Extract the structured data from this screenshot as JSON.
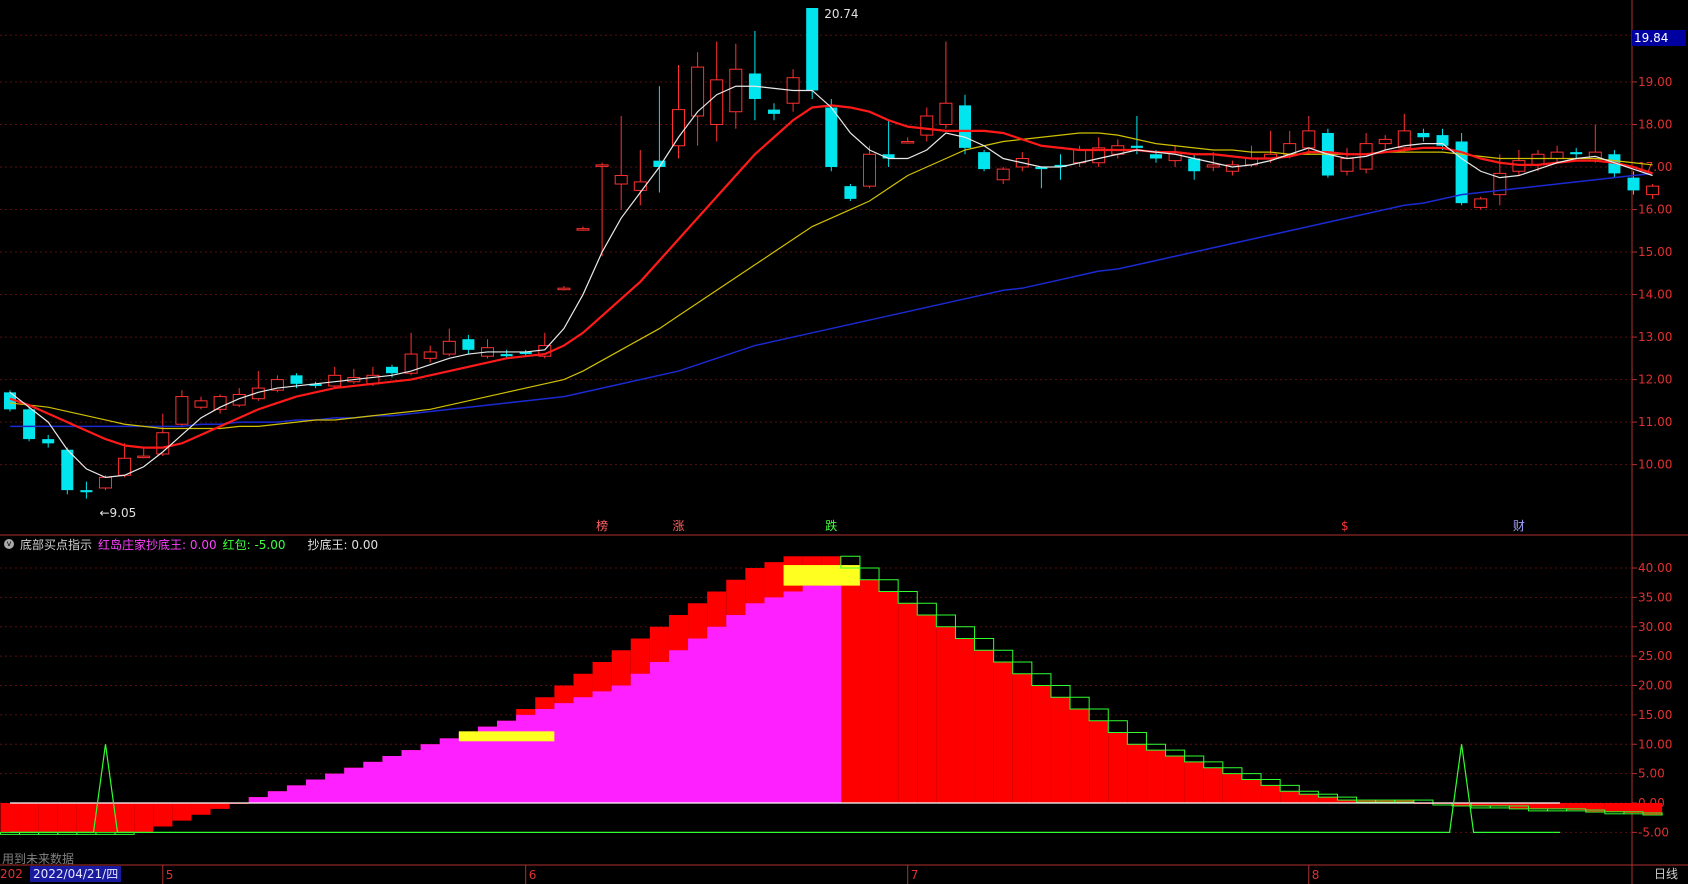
{
  "panel": {
    "title": "底部买点指示",
    "legend": [
      {
        "label": "红岛庄家抄底王: 0.00",
        "color": "#ff40ff"
      },
      {
        "label": "红包: -5.00",
        "color": "#40ff40"
      },
      {
        "label": "抄底王: 0.00",
        "color": "#e0e0e0"
      }
    ]
  },
  "footer": {
    "future_note": "用到未来数据",
    "date_prefix": "202",
    "current_date": "2022/04/21/四",
    "period": "日线",
    "month_marks": [
      "5",
      "6",
      "7",
      "8"
    ]
  },
  "price_tag": "19.84",
  "markers": {
    "high_label": "20.74",
    "low_label": "←9.05",
    "events": [
      "榜",
      "涨",
      "跌",
      "$",
      "财"
    ]
  },
  "chart_data": [
    {
      "type": "candlestick",
      "y_ticks": [
        "19.00",
        "18.00",
        "17.00",
        "16.00",
        "15.00",
        "14.00",
        "13.00",
        "12.00",
        "11.00",
        "10.00"
      ],
      "ylim": [
        9.05,
        20.74
      ],
      "grid": true,
      "candles": [
        [
          11.7,
          11.3,
          11.75,
          11.25
        ],
        [
          11.3,
          10.6,
          11.35,
          10.55
        ],
        [
          10.6,
          10.5,
          10.7,
          10.4
        ],
        [
          10.35,
          9.4,
          10.4,
          9.3
        ],
        [
          9.4,
          9.35,
          9.6,
          9.2
        ],
        [
          9.45,
          9.7,
          9.75,
          9.4
        ],
        [
          9.75,
          10.15,
          10.5,
          9.7
        ],
        [
          10.2,
          10.2,
          10.4,
          10.15
        ],
        [
          10.25,
          10.75,
          11.2,
          10.2
        ],
        [
          10.95,
          11.6,
          11.75,
          10.9
        ],
        [
          11.35,
          11.5,
          11.6,
          11.3
        ],
        [
          11.3,
          11.6,
          11.65,
          11.2
        ],
        [
          11.4,
          11.65,
          11.8,
          11.35
        ],
        [
          11.55,
          11.8,
          12.2,
          11.5
        ],
        [
          11.75,
          12.0,
          12.1,
          11.7
        ],
        [
          12.1,
          11.9,
          12.15,
          11.8
        ],
        [
          11.9,
          11.85,
          11.95,
          11.8
        ],
        [
          11.85,
          12.1,
          12.3,
          11.8
        ],
        [
          11.95,
          12.05,
          12.25,
          11.9
        ],
        [
          11.9,
          12.1,
          12.3,
          11.85
        ],
        [
          12.3,
          12.15,
          12.35,
          12.05
        ],
        [
          12.15,
          12.6,
          13.1,
          12.1
        ],
        [
          12.5,
          12.65,
          12.8,
          12.4
        ],
        [
          12.6,
          12.9,
          13.2,
          12.55
        ],
        [
          12.95,
          12.7,
          13.05,
          12.6
        ],
        [
          12.55,
          12.75,
          12.95,
          12.5
        ],
        [
          12.6,
          12.55,
          12.7,
          12.5
        ],
        [
          12.65,
          12.6,
          12.7,
          12.55
        ],
        [
          12.55,
          12.8,
          13.1,
          12.5
        ],
        [
          14.15,
          14.15,
          14.2,
          14.1
        ],
        [
          15.55,
          15.55,
          15.6,
          15.5
        ],
        [
          17.05,
          17.05,
          17.1,
          14.9
        ],
        [
          16.6,
          16.8,
          18.2,
          16.0
        ],
        [
          16.45,
          16.65,
          17.4,
          16.1
        ],
        [
          17.15,
          17.0,
          18.9,
          16.4
        ],
        [
          17.5,
          18.35,
          19.4,
          17.2
        ],
        [
          18.2,
          19.35,
          19.7,
          17.5
        ],
        [
          18.0,
          19.05,
          19.95,
          17.6
        ],
        [
          18.3,
          19.3,
          19.9,
          17.9
        ],
        [
          19.2,
          18.6,
          20.2,
          18.1
        ],
        [
          18.35,
          18.25,
          18.5,
          18.1
        ],
        [
          18.5,
          19.1,
          19.3,
          18.3
        ],
        [
          20.74,
          18.8,
          20.74,
          18.6
        ],
        [
          18.4,
          17.0,
          18.6,
          16.9
        ],
        [
          16.55,
          16.25,
          16.6,
          16.2
        ],
        [
          16.55,
          17.3,
          17.5,
          16.5
        ],
        [
          17.3,
          17.2,
          18.1,
          17.0
        ],
        [
          17.6,
          17.6,
          17.7,
          17.55
        ],
        [
          17.75,
          18.2,
          18.4,
          17.6
        ],
        [
          18.0,
          18.5,
          19.95,
          17.9
        ],
        [
          18.45,
          17.45,
          18.7,
          17.3
        ],
        [
          17.35,
          16.95,
          17.4,
          16.9
        ],
        [
          16.7,
          16.95,
          17.0,
          16.6
        ],
        [
          17.0,
          17.2,
          17.35,
          16.9
        ],
        [
          17.0,
          16.95,
          17.0,
          16.5
        ],
        [
          17.05,
          17.0,
          17.3,
          16.7
        ],
        [
          17.1,
          17.4,
          17.5,
          17.0
        ],
        [
          17.1,
          17.45,
          17.7,
          17.0
        ],
        [
          17.3,
          17.5,
          17.65,
          17.2
        ],
        [
          17.5,
          17.45,
          18.2,
          17.3
        ],
        [
          17.3,
          17.2,
          17.4,
          17.1
        ],
        [
          17.15,
          17.35,
          17.5,
          17.0
        ],
        [
          17.2,
          16.9,
          17.3,
          16.7
        ],
        [
          17.0,
          17.05,
          17.35,
          16.9
        ],
        [
          16.9,
          17.05,
          17.15,
          16.8
        ],
        [
          17.05,
          17.2,
          17.5,
          17.0
        ],
        [
          17.2,
          17.3,
          17.85,
          17.1
        ],
        [
          17.3,
          17.55,
          17.85,
          17.2
        ],
        [
          17.45,
          17.85,
          18.2,
          17.3
        ],
        [
          17.8,
          16.8,
          17.9,
          16.75
        ],
        [
          16.9,
          17.2,
          17.45,
          16.8
        ],
        [
          16.95,
          17.55,
          17.8,
          16.85
        ],
        [
          17.55,
          17.65,
          17.75,
          17.4
        ],
        [
          17.45,
          17.85,
          18.25,
          17.35
        ],
        [
          17.8,
          17.7,
          17.9,
          17.6
        ],
        [
          17.75,
          17.5,
          17.9,
          17.4
        ],
        [
          17.6,
          16.15,
          17.8,
          16.1
        ],
        [
          16.05,
          16.25,
          16.3,
          16.0
        ],
        [
          16.35,
          16.85,
          17.3,
          16.1
        ],
        [
          16.9,
          17.15,
          17.4,
          16.8
        ],
        [
          17.05,
          17.3,
          17.4,
          16.9
        ],
        [
          17.2,
          17.35,
          17.5,
          17.1
        ],
        [
          17.35,
          17.3,
          17.45,
          17.2
        ],
        [
          17.2,
          17.35,
          18.0,
          17.1
        ],
        [
          17.3,
          16.85,
          17.4,
          16.75
        ],
        [
          16.75,
          16.45,
          16.9,
          16.35
        ],
        [
          16.35,
          16.55,
          16.6,
          16.25
        ]
      ],
      "ma_short": [
        11.7,
        11.35,
        11.0,
        10.35,
        9.9,
        9.7,
        9.75,
        9.95,
        10.3,
        10.7,
        11.1,
        11.35,
        11.55,
        11.7,
        11.8,
        11.85,
        11.9,
        11.95,
        12.0,
        12.05,
        12.1,
        12.2,
        12.35,
        12.5,
        12.6,
        12.65,
        12.65,
        12.65,
        12.7,
        13.2,
        14.0,
        15.0,
        15.8,
        16.4,
        17.0,
        17.7,
        18.3,
        18.7,
        18.9,
        18.9,
        18.85,
        18.8,
        18.8,
        18.4,
        17.8,
        17.4,
        17.2,
        17.2,
        17.4,
        17.8,
        17.7,
        17.5,
        17.2,
        17.1,
        17.0,
        17.0,
        17.1,
        17.2,
        17.3,
        17.4,
        17.35,
        17.3,
        17.2,
        17.1,
        17.0,
        17.05,
        17.15,
        17.3,
        17.45,
        17.3,
        17.2,
        17.25,
        17.4,
        17.5,
        17.55,
        17.55,
        17.2,
        16.9,
        16.75,
        16.8,
        16.95,
        17.1,
        17.2,
        17.25,
        17.1,
        16.95,
        16.8
      ],
      "ma_mid": [
        11.55,
        11.4,
        11.2,
        11.0,
        10.8,
        10.6,
        10.45,
        10.4,
        10.4,
        10.5,
        10.7,
        10.9,
        11.1,
        11.3,
        11.45,
        11.6,
        11.7,
        11.8,
        11.85,
        11.9,
        11.95,
        12.0,
        12.1,
        12.2,
        12.3,
        12.4,
        12.5,
        12.55,
        12.6,
        12.8,
        13.1,
        13.5,
        13.9,
        14.3,
        14.8,
        15.3,
        15.8,
        16.3,
        16.8,
        17.3,
        17.7,
        18.1,
        18.4,
        18.45,
        18.4,
        18.3,
        18.1,
        17.95,
        17.9,
        17.85,
        17.85,
        17.85,
        17.8,
        17.65,
        17.5,
        17.45,
        17.4,
        17.4,
        17.4,
        17.4,
        17.35,
        17.35,
        17.3,
        17.3,
        17.25,
        17.2,
        17.2,
        17.25,
        17.35,
        17.35,
        17.3,
        17.3,
        17.35,
        17.4,
        17.45,
        17.45,
        17.35,
        17.2,
        17.1,
        17.05,
        17.05,
        17.1,
        17.15,
        17.15,
        17.1,
        17.0,
        16.85
      ],
      "ma_long": [
        11.45,
        11.4,
        11.35,
        11.25,
        11.15,
        11.05,
        10.95,
        10.9,
        10.85,
        10.85,
        10.85,
        10.85,
        10.9,
        10.9,
        10.95,
        11.0,
        11.05,
        11.05,
        11.1,
        11.15,
        11.2,
        11.25,
        11.3,
        11.4,
        11.5,
        11.6,
        11.7,
        11.8,
        11.9,
        12.0,
        12.2,
        12.45,
        12.7,
        12.95,
        13.2,
        13.5,
        13.8,
        14.1,
        14.4,
        14.7,
        15.0,
        15.3,
        15.6,
        15.8,
        16.0,
        16.2,
        16.5,
        16.8,
        17.0,
        17.2,
        17.4,
        17.5,
        17.6,
        17.65,
        17.7,
        17.75,
        17.8,
        17.8,
        17.75,
        17.65,
        17.55,
        17.5,
        17.45,
        17.4,
        17.4,
        17.35,
        17.35,
        17.3,
        17.3,
        17.3,
        17.3,
        17.3,
        17.35,
        17.35,
        17.35,
        17.35,
        17.3,
        17.25,
        17.2,
        17.2,
        17.2,
        17.2,
        17.2,
        17.2,
        17.15,
        17.1,
        17.05
      ],
      "ma_blue": [
        10.9,
        10.9,
        10.9,
        10.9,
        10.9,
        10.9,
        10.9,
        10.9,
        10.9,
        10.9,
        10.95,
        10.95,
        11.0,
        11.0,
        11.0,
        11.05,
        11.05,
        11.1,
        11.1,
        11.15,
        11.15,
        11.2,
        11.25,
        11.3,
        11.35,
        11.4,
        11.45,
        11.5,
        11.55,
        11.6,
        11.7,
        11.8,
        11.9,
        12.0,
        12.1,
        12.2,
        12.35,
        12.5,
        12.65,
        12.8,
        12.9,
        13.0,
        13.1,
        13.2,
        13.3,
        13.4,
        13.5,
        13.6,
        13.7,
        13.8,
        13.9,
        14.0,
        14.1,
        14.15,
        14.25,
        14.35,
        14.45,
        14.55,
        14.6,
        14.7,
        14.8,
        14.9,
        15.0,
        15.1,
        15.2,
        15.3,
        15.4,
        15.5,
        15.6,
        15.7,
        15.8,
        15.9,
        16.0,
        16.1,
        16.15,
        16.25,
        16.35,
        16.4,
        16.45,
        16.5,
        16.55,
        16.6,
        16.65,
        16.7,
        16.75,
        16.8,
        16.85
      ]
    },
    {
      "type": "indicator",
      "y_ticks": [
        "40.00",
        "35.00",
        "30.00",
        "25.00",
        "20.00",
        "15.00",
        "10.00",
        "5.00",
        "0.00",
        "-5.00"
      ],
      "ylim": [
        -8,
        43
      ],
      "red_steps": [
        -5,
        -5,
        -5,
        -5,
        -5,
        -5,
        -5,
        -5,
        -4,
        -3,
        -2,
        -1,
        0,
        1,
        2,
        3,
        4,
        5,
        6,
        7,
        8,
        9,
        10,
        11,
        12,
        13,
        14,
        16,
        18,
        20,
        22,
        24,
        26,
        28,
        30,
        32,
        34,
        36,
        38,
        40,
        41,
        42,
        42,
        42,
        40,
        38,
        36,
        34,
        32,
        30,
        28,
        26,
        24,
        22,
        20,
        18,
        16,
        14,
        12,
        10,
        9,
        8,
        7,
        6,
        5,
        4,
        3,
        2,
        1.5,
        1,
        0.5,
        0.5,
        0.5,
        0.5,
        0,
        0,
        -0.5,
        -0.5,
        -0.5,
        -1,
        -1,
        -1,
        -1.2,
        -1.5,
        -1.5,
        -1.7,
        -2
      ],
      "magenta_steps": [
        0,
        0,
        0,
        0,
        0,
        0,
        0,
        0,
        0,
        0,
        0,
        0,
        0,
        1,
        2,
        3,
        4,
        5,
        6,
        7,
        8,
        9,
        10,
        11,
        12,
        13,
        14,
        15,
        16,
        17,
        18,
        19,
        20,
        22,
        24,
        26,
        28,
        30,
        32,
        34,
        35,
        36,
        37,
        38,
        0,
        0,
        0,
        0,
        0,
        0,
        0,
        0,
        0,
        0,
        0,
        0,
        0,
        0,
        0,
        0,
        0,
        0,
        0,
        0,
        0,
        0,
        0,
        0,
        0,
        0,
        0,
        0,
        0,
        0,
        0,
        0,
        0,
        0,
        0,
        0,
        0,
        0,
        0,
        0,
        0,
        0,
        0
      ],
      "green_baseline": -5,
      "spikes": [
        5,
        76
      ],
      "zero_line": 0
    }
  ]
}
